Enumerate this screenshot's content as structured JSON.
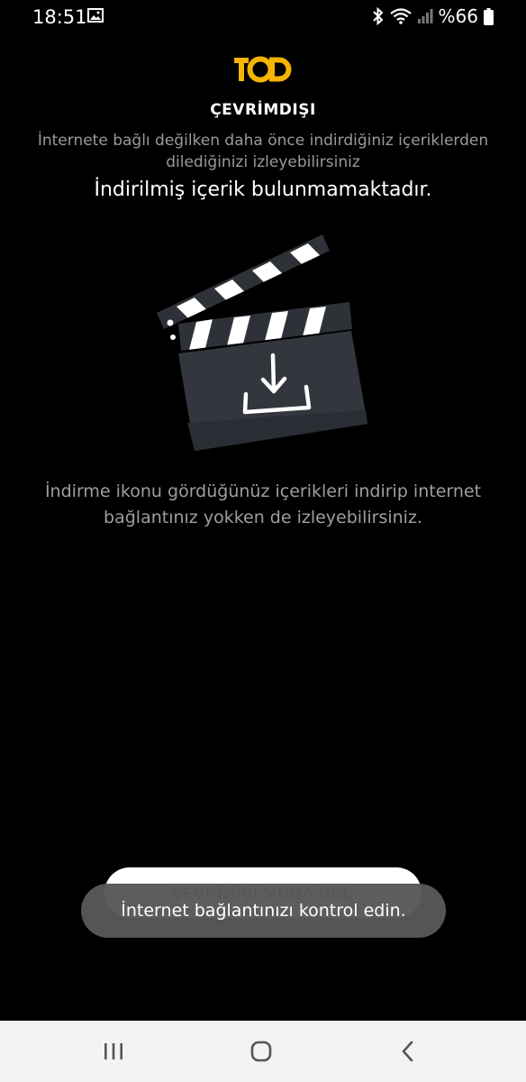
{
  "status_bar": {
    "time": "18:51",
    "battery": "%66",
    "icons": [
      "gallery-icon",
      "bluetooth-icon",
      "wifi-icon",
      "signal-icon",
      "battery-icon"
    ]
  },
  "brand": {
    "logo_text": "TOD",
    "accent": "#f5b400"
  },
  "header": {
    "title": "ÇEVRİMDIŞI",
    "subtitle": "İnternete bağlı değilken daha önce indirdiğiniz içeriklerden dilediğinizi izleyebilirsiniz"
  },
  "empty_state": {
    "message": "İndirilmiş içerik bulunmamaktadır.",
    "illustration": "clapperboard-download-icon",
    "hint": "İndirme ikonu gördüğünüz içerikleri indirip internet bağlantınız yokken de izleyebilirsiniz."
  },
  "actions": {
    "online_mode_button": "ÇEVRİMİÇİ MODA GEÇ"
  },
  "toast": {
    "message": "İnternet bağlantınızı kontrol edin."
  },
  "nav_bar": {
    "buttons": [
      "recents-icon",
      "home-icon",
      "back-icon"
    ]
  }
}
